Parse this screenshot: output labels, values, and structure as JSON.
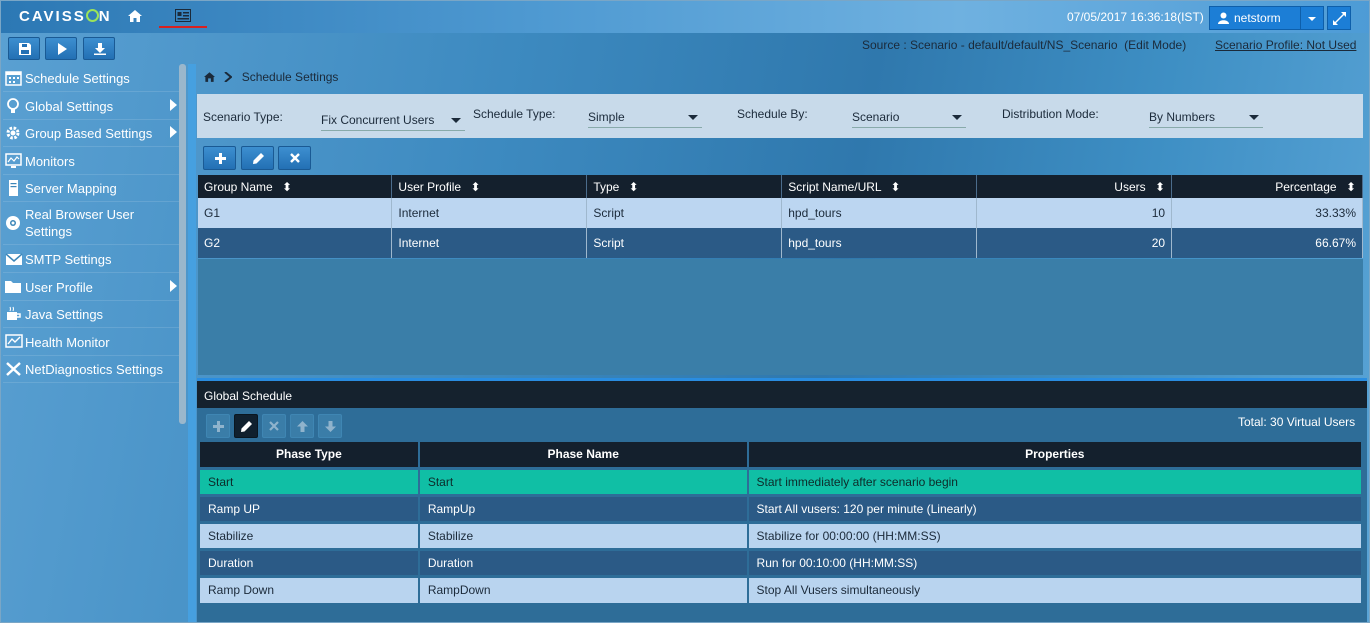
{
  "app": {
    "logo": "CAVISSON",
    "datetime": "07/05/2017 16:36:18(IST)",
    "user": "netstorm"
  },
  "toolbar": {
    "source_prefix": "Source : Scenario - ",
    "source_path": "default/default/NS_Scenario",
    "mode": "(Edit Mode)",
    "profile_label": "Scenario Profile:",
    "profile_value": "Not Used"
  },
  "sidebar": {
    "items": [
      {
        "label": "Schedule Settings",
        "icon": "calendar-icon",
        "has_arrow": false
      },
      {
        "label": "Global Settings",
        "icon": "bulb-icon",
        "has_arrow": true
      },
      {
        "label": "Group Based Settings",
        "icon": "gear-icon",
        "has_arrow": true
      },
      {
        "label": "Monitors",
        "icon": "monitor-icon",
        "has_arrow": false
      },
      {
        "label": "Server Mapping",
        "icon": "server-icon",
        "has_arrow": false
      },
      {
        "label": "Real Browser User Settings",
        "icon": "browser-icon",
        "has_arrow": false
      },
      {
        "label": "SMTP Settings",
        "icon": "mail-icon",
        "has_arrow": false
      },
      {
        "label": "User Profile",
        "icon": "folder-icon",
        "has_arrow": true
      },
      {
        "label": "Java Settings",
        "icon": "coffee-icon",
        "has_arrow": false
      },
      {
        "label": "Health Monitor",
        "icon": "chart-icon",
        "has_arrow": false
      },
      {
        "label": "NetDiagnostics Settings",
        "icon": "tools-icon",
        "has_arrow": false
      }
    ]
  },
  "breadcrumb": {
    "current": "Schedule Settings"
  },
  "filters": {
    "scenario_type_label": "Scenario Type:",
    "scenario_type_value": "Fix Concurrent Users",
    "schedule_type_label": "Schedule Type:",
    "schedule_type_value": "Simple",
    "schedule_by_label": "Schedule By:",
    "schedule_by_value": "Scenario",
    "distribution_label": "Distribution Mode:",
    "distribution_value": "By Numbers"
  },
  "groups": {
    "columns": [
      "Group Name",
      "User Profile",
      "Type",
      "Script Name/URL",
      "Users",
      "Percentage"
    ],
    "rows": [
      {
        "group": "G1",
        "profile": "Internet",
        "type": "Script",
        "script": "hpd_tours",
        "users": "10",
        "percentage": "33.33%"
      },
      {
        "group": "G2",
        "profile": "Internet",
        "type": "Script",
        "script": "hpd_tours",
        "users": "20",
        "percentage": "66.67%"
      }
    ]
  },
  "global_schedule": {
    "title": "Global Schedule",
    "total": "Total: 30 Virtual Users",
    "columns": [
      "Phase Type",
      "Phase Name",
      "Properties"
    ],
    "rows": [
      {
        "type": "Start",
        "name": "Start",
        "props": "Start immediately after scenario begin"
      },
      {
        "type": "Ramp UP",
        "name": "RampUp",
        "props": "Start All vusers: 120 per minute (Linearly)"
      },
      {
        "type": "Stabilize",
        "name": "Stabilize",
        "props": "Stabilize for 00:00:00 (HH:MM:SS)"
      },
      {
        "type": "Duration",
        "name": "Duration",
        "props": "Run for 00:10:00 (HH:MM:SS)"
      },
      {
        "type": "Ramp Down",
        "name": "RampDown",
        "props": "Stop All Vusers simultaneously"
      }
    ]
  }
}
